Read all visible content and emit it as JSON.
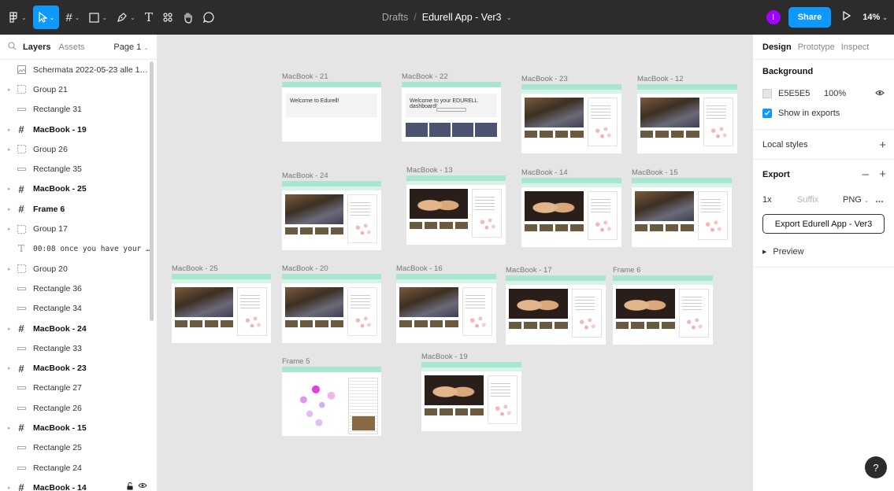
{
  "toolbar": {
    "main_menu_icon": "figma-logo-icon",
    "tools": [
      {
        "name": "move-tool",
        "icon": "cursor-icon"
      },
      {
        "name": "frame-tool",
        "icon": "hash-icon"
      },
      {
        "name": "shape-tool",
        "icon": "rectangle-icon"
      },
      {
        "name": "pen-tool",
        "icon": "pen-icon"
      },
      {
        "name": "text-tool",
        "icon": "text-icon",
        "glyph": "T"
      },
      {
        "name": "resources-tool",
        "icon": "components-icon"
      },
      {
        "name": "hand-tool",
        "icon": "hand-icon"
      },
      {
        "name": "comment-tool",
        "icon": "comment-icon"
      }
    ],
    "breadcrumb_folder": "Drafts",
    "breadcrumb_separator": "/",
    "file_name": "Edurell App - Ver3",
    "avatar_initial": "I",
    "share_label": "Share",
    "zoom": "14%"
  },
  "left_panel": {
    "tab_layers": "Layers",
    "tab_assets": "Assets",
    "page_selector": "Page 1",
    "layers": [
      {
        "name": "Schermata 2022-05-23 alle 15.53",
        "type": "image",
        "bold": false,
        "expandable": false
      },
      {
        "name": "Group 21",
        "type": "group",
        "bold": false,
        "expandable": true
      },
      {
        "name": "Rectangle 31",
        "type": "rectangle",
        "bold": false,
        "expandable": false
      },
      {
        "name": "MacBook - 19",
        "type": "frame",
        "bold": true,
        "expandable": true
      },
      {
        "name": "Group 26",
        "type": "group",
        "bold": false,
        "expandable": true
      },
      {
        "name": "Rectangle 35",
        "type": "rectangle",
        "bold": false,
        "expandable": false
      },
      {
        "name": "MacBook - 25",
        "type": "frame",
        "bold": true,
        "expandable": true
      },
      {
        "name": "Frame 6",
        "type": "frame",
        "bold": true,
        "expandable": true
      },
      {
        "name": "Group 17",
        "type": "group",
        "bold": false,
        "expandable": true
      },
      {
        "name": "00:08 once you have your skeleto...",
        "type": "text",
        "bold": false,
        "expandable": false
      },
      {
        "name": "Group 20",
        "type": "group",
        "bold": false,
        "expandable": true
      },
      {
        "name": "Rectangle 36",
        "type": "rectangle",
        "bold": false,
        "expandable": false
      },
      {
        "name": "Rectangle 34",
        "type": "rectangle",
        "bold": false,
        "expandable": false
      },
      {
        "name": "MacBook - 24",
        "type": "frame",
        "bold": true,
        "expandable": true
      },
      {
        "name": "Rectangle 33",
        "type": "rectangle",
        "bold": false,
        "expandable": false
      },
      {
        "name": "MacBook - 23",
        "type": "frame",
        "bold": true,
        "expandable": true
      },
      {
        "name": "Rectangle 27",
        "type": "rectangle",
        "bold": false,
        "expandable": false
      },
      {
        "name": "Rectangle 26",
        "type": "rectangle",
        "bold": false,
        "expandable": false
      },
      {
        "name": "MacBook - 15",
        "type": "frame",
        "bold": true,
        "expandable": true
      },
      {
        "name": "Rectangle 25",
        "type": "rectangle",
        "bold": false,
        "expandable": false
      },
      {
        "name": "Rectangle 24",
        "type": "rectangle",
        "bold": false,
        "expandable": false
      },
      {
        "name": "MacBook - 14",
        "type": "frame",
        "bold": true,
        "expandable": true,
        "lock_icon": "unlock-icon",
        "eye_icon": "eye-icon"
      }
    ]
  },
  "canvas": {
    "background": "#E5E5E5",
    "frames": [
      {
        "label": "MacBook - 21",
        "kind": "welcome"
      },
      {
        "label": "MacBook - 22",
        "kind": "dashboard"
      },
      {
        "label": "MacBook - 23",
        "kind": "video"
      },
      {
        "label": "MacBook - 12",
        "kind": "video"
      },
      {
        "label": "MacBook - 24",
        "kind": "video-notes"
      },
      {
        "label": "MacBook - 13",
        "kind": "pelvis"
      },
      {
        "label": "MacBook - 14",
        "kind": "pelvis"
      },
      {
        "label": "MacBook - 15",
        "kind": "video"
      },
      {
        "label": "MacBook - 25",
        "kind": "video"
      },
      {
        "label": "MacBook - 20",
        "kind": "video"
      },
      {
        "label": "MacBook - 16",
        "kind": "video"
      },
      {
        "label": "MacBook - 17",
        "kind": "pelvis"
      },
      {
        "label": "Frame 6",
        "kind": "pelvis"
      },
      {
        "label": "Frame 5",
        "kind": "concept-map"
      },
      {
        "label": "MacBook - 19",
        "kind": "pelvis"
      }
    ],
    "welcome_text": "Welcome to Edurell!",
    "dashboard_text": "Welcome to your EDURELL dashboard!"
  },
  "right_panel": {
    "tab_design": "Design",
    "tab_prototype": "Prototype",
    "tab_inspect": "Inspect",
    "background_title": "Background",
    "background_hex": "E5E5E5",
    "background_opacity": "100%",
    "show_in_exports": "Show in exports",
    "local_styles": "Local styles",
    "export_title": "Export",
    "export_scale": "1x",
    "export_suffix_placeholder": "Suffix",
    "export_format": "PNG",
    "export_button": "Export Edurell App - Ver3",
    "preview_label": "Preview",
    "help": "?"
  }
}
